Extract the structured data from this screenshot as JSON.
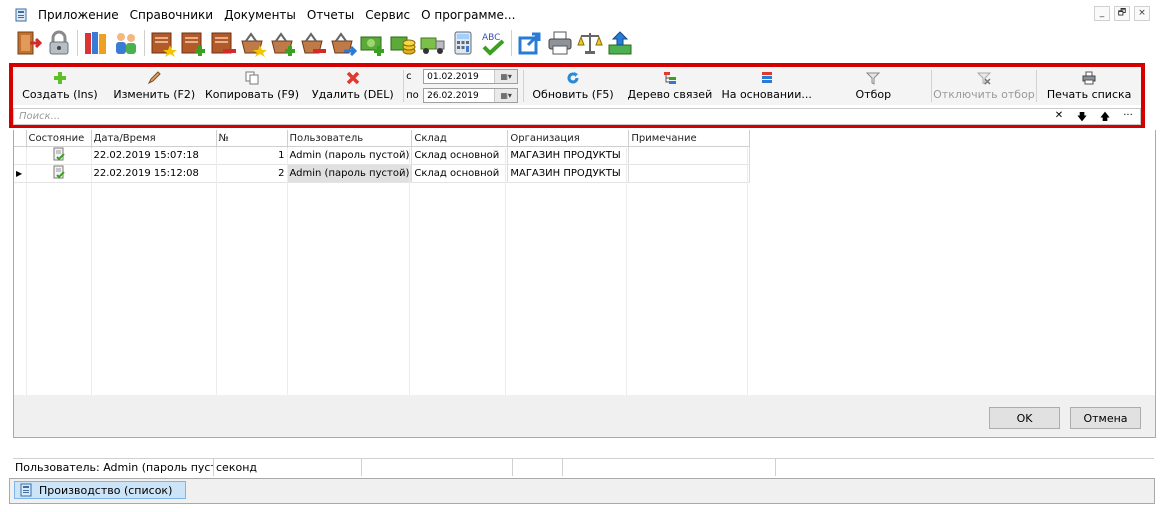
{
  "menu": {
    "items": [
      "Приложение",
      "Справочники",
      "Документы",
      "Отчеты",
      "Сервис",
      "О программе..."
    ]
  },
  "window_controls": {
    "minimize": "_",
    "restore": "🗗",
    "close": "×"
  },
  "main_toolbar": {
    "icons": [
      "exit-icon",
      "lock-icon",
      "books-icon",
      "users-icon",
      "doc-star-icon",
      "doc-add-icon",
      "doc-remove-icon",
      "basket-star-icon",
      "basket-add-icon",
      "basket-remove-icon",
      "basket-move-icon",
      "money-icon",
      "coins-icon",
      "truck-icon",
      "calculator-icon",
      "spellcheck-icon",
      "export-icon",
      "printer-icon",
      "scales-icon",
      "upload-icon"
    ]
  },
  "actions": {
    "create": "Создать (Ins)",
    "edit": "Изменить (F2)",
    "copy": "Копировать (F9)",
    "delete": "Удалить (DEL)",
    "refresh": "Обновить (F5)",
    "tree": "Дерево связей",
    "based_on": "На основании...",
    "filter": "Отбор",
    "filter_off": "Отключить отбор",
    "print": "Печать списка"
  },
  "period": {
    "from_label": "с",
    "to_label": "по",
    "from": "01.02.2019",
    "to": "26.02.2019"
  },
  "search": {
    "placeholder": "Поиск..."
  },
  "search_controls": {
    "clear": "✕",
    "down": "🡇",
    "up": "🡅",
    "more": "···"
  },
  "grid": {
    "columns": [
      "Состояние",
      "Дата/Время",
      "№",
      "Пользователь",
      "Склад",
      "Организация",
      "Примечание"
    ],
    "rows": [
      {
        "datetime": "22.02.2019 15:07:18",
        "num": "1",
        "user": "Admin (пароль пустой)",
        "warehouse": "Склад основной",
        "org": "МАГАЗИН ПРОДУКТЫ",
        "note": ""
      },
      {
        "datetime": "22.02.2019 15:12:08",
        "num": "2",
        "user": "Admin (пароль пустой)",
        "warehouse": "Склад основной",
        "org": "МАГАЗИН ПРОДУКТЫ",
        "note": ""
      }
    ]
  },
  "dialog": {
    "ok": "OK",
    "cancel": "Отмена"
  },
  "status": {
    "user": "Пользователь: Admin (пароль пусто",
    "seconds": "секонд"
  },
  "taskbar": {
    "item": "Производство (список)"
  },
  "colors": {
    "accent_red": "#d40000",
    "task_blue": "#cce4f7",
    "plus_green": "#5fbf2a",
    "delete_red": "#e03a2f"
  }
}
